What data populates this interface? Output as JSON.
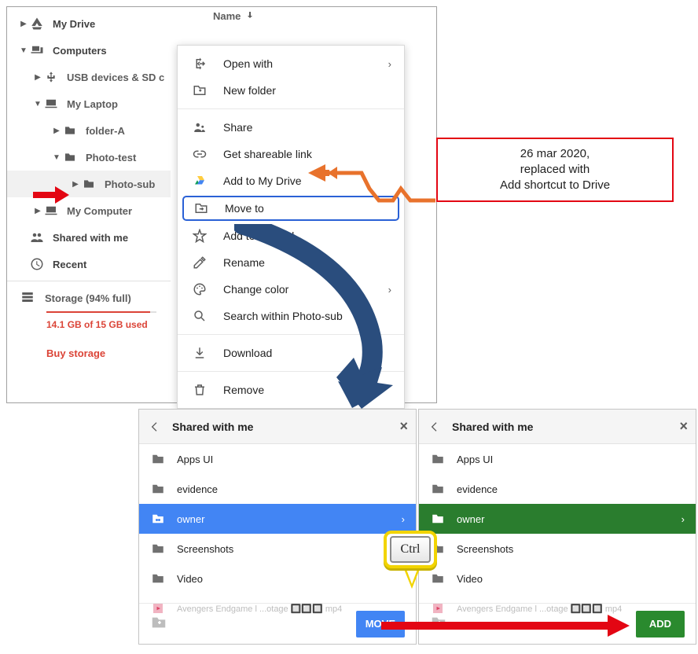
{
  "header": {
    "name_col": "Name"
  },
  "tree": {
    "my_drive": "My Drive",
    "computers": "Computers",
    "usb": "USB devices & SD c",
    "laptop": "My Laptop",
    "folderA": "folder-A",
    "photoTest": "Photo-test",
    "photoSub": "Photo-sub",
    "myComputer": "My Computer",
    "shared": "Shared with me",
    "recent": "Recent"
  },
  "storage": {
    "label": "Storage (94% full)",
    "usage": "14.1 GB of 15 GB used",
    "buy": "Buy storage",
    "percent": 94
  },
  "ctx": {
    "open_with": "Open with",
    "new_folder": "New folder",
    "share": "Share",
    "get_link": "Get shareable link",
    "add_drive": "Add to My Drive",
    "move_to": "Move to",
    "add_star": "Add to Starred",
    "rename": "Rename",
    "change_color": "Change color",
    "search_within": "Search within Photo-sub",
    "download": "Download",
    "remove": "Remove"
  },
  "callout": {
    "line1": "26 mar 2020,",
    "line2": "replaced with",
    "line3": "Add shortcut to Drive"
  },
  "picker": {
    "title": "Shared with me",
    "items": {
      "apps": "Apps UI",
      "evidence": "evidence",
      "owner": "owner",
      "screenshots": "Screenshots",
      "video": "Video",
      "avengers": "Avengers Endgame l ...otage 🔲🔲🔲 mp4"
    },
    "move_btn": "MOVE",
    "add_btn": "ADD"
  },
  "key": {
    "ctrl": "Ctrl"
  }
}
